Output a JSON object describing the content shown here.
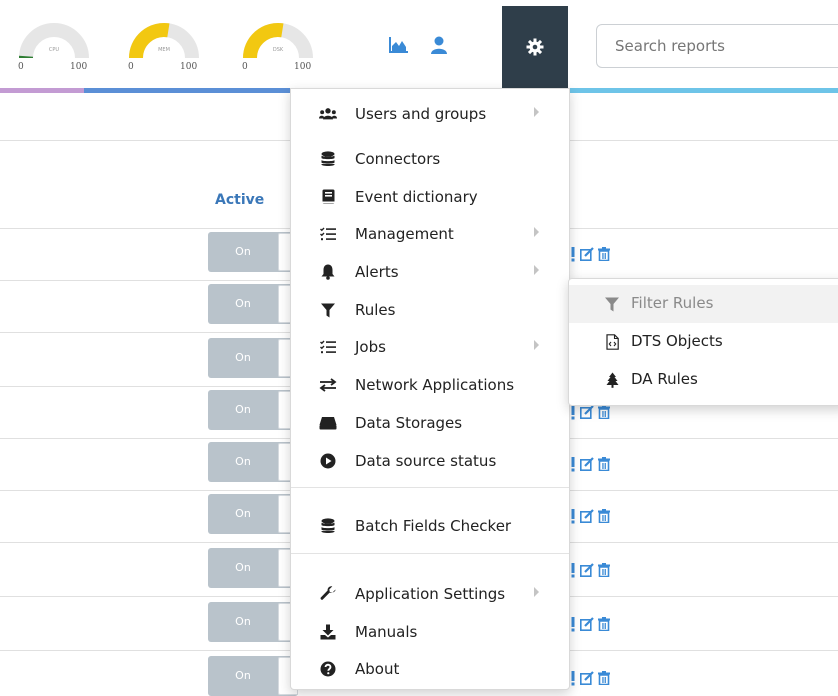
{
  "gauges": [
    {
      "name": "CPU",
      "min": "0",
      "max": "100",
      "level": 0.02,
      "color": "#2e7d32"
    },
    {
      "name": "MEM",
      "min": "0",
      "max": "100",
      "level": 0.55,
      "color": "#f2c811"
    },
    {
      "name": "DSK",
      "min": "0",
      "max": "100",
      "level": 0.55,
      "color": "#f2c811"
    }
  ],
  "topnav": {
    "chart_icon": "area-chart-icon",
    "user_icon": "user-icon",
    "settings_icon": "gear-icon",
    "search_placeholder": "Search reports"
  },
  "colors": {
    "accent": "#3a77b8",
    "nav_dark": "#2f3e4a",
    "toggle_off": "#b9c3cb",
    "bar_purple": "#c39bd3",
    "bar_blue": "#5b8fd6",
    "bar_cyan": "#6ec4e8"
  },
  "table": {
    "active_header": "Active",
    "rows": [
      {
        "toggle": "On"
      },
      {
        "toggle": "On"
      },
      {
        "toggle": "On"
      },
      {
        "toggle": "On"
      },
      {
        "toggle": "On"
      },
      {
        "toggle": "On"
      },
      {
        "toggle": "On"
      },
      {
        "toggle": "On"
      },
      {
        "toggle": "On"
      }
    ]
  },
  "menu": {
    "items": [
      {
        "label": "Users and groups",
        "icon": "users-icon",
        "submenu": true
      },
      {
        "label": "Connectors",
        "icon": "database-icon",
        "submenu": false
      },
      {
        "label": "Event dictionary",
        "icon": "book-icon",
        "submenu": false
      },
      {
        "label": "Management",
        "icon": "tasks-icon",
        "submenu": true
      },
      {
        "label": "Alerts",
        "icon": "bell-icon",
        "submenu": true
      },
      {
        "label": "Rules",
        "icon": "filter-icon",
        "submenu": false
      },
      {
        "label": "Jobs",
        "icon": "tasks-icon",
        "submenu": true
      },
      {
        "label": "Network Applications",
        "icon": "exchange-icon",
        "submenu": false
      },
      {
        "label": "Data Storages",
        "icon": "hdd-icon",
        "submenu": false
      },
      {
        "label": "Data source status",
        "icon": "play-circle-icon",
        "submenu": false
      },
      {
        "label": "Batch Fields Checker",
        "icon": "database-icon",
        "submenu": false
      },
      {
        "label": "Application Settings",
        "icon": "wrench-icon",
        "submenu": true
      },
      {
        "label": "Manuals",
        "icon": "download-icon",
        "submenu": false
      },
      {
        "label": "About",
        "icon": "question-circle-icon",
        "submenu": false
      }
    ]
  },
  "submenu": {
    "items": [
      {
        "label": "Filter Rules",
        "icon": "filter-icon",
        "highlighted": true
      },
      {
        "label": "DTS Objects",
        "icon": "file-code-icon",
        "highlighted": false
      },
      {
        "label": "DA Rules",
        "icon": "tree-icon",
        "highlighted": false
      }
    ]
  }
}
